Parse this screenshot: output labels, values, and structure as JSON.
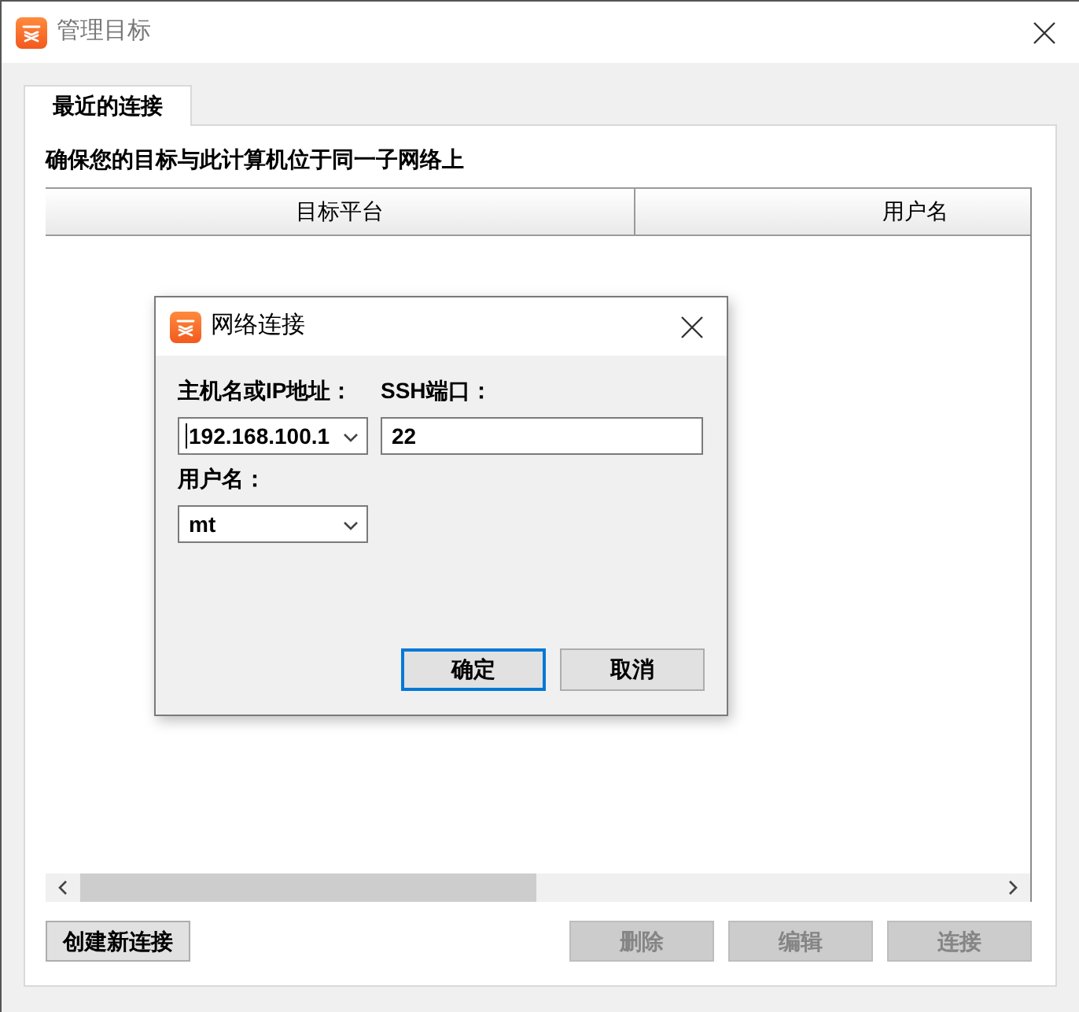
{
  "window": {
    "title": "管理目标"
  },
  "tabs": [
    {
      "label": "最近的连接",
      "selected": true
    }
  ],
  "notice": "确保您的目标与此计算机位于同一子网络上",
  "table": {
    "columns": [
      "目标平台",
      "用户名"
    ]
  },
  "actions": [
    {
      "label": "创建新连接",
      "disabled": false
    },
    {
      "label": "删除",
      "disabled": true
    },
    {
      "label": "编辑",
      "disabled": true
    },
    {
      "label": "连接",
      "disabled": true
    }
  ],
  "dialog": {
    "title": "网络连接",
    "fields": [
      {
        "kind": "combo",
        "label": "主机名或IP地址：",
        "value": "192.168.100.1",
        "focused": true
      },
      {
        "kind": "text",
        "label": "SSH端口：",
        "value": "22",
        "focused": false
      },
      {
        "kind": "combo",
        "label": "用户名：",
        "value": "mt",
        "focused": false
      }
    ],
    "buttons": [
      {
        "label": "确定",
        "focused": true
      },
      {
        "label": "取消",
        "focused": false
      }
    ]
  }
}
